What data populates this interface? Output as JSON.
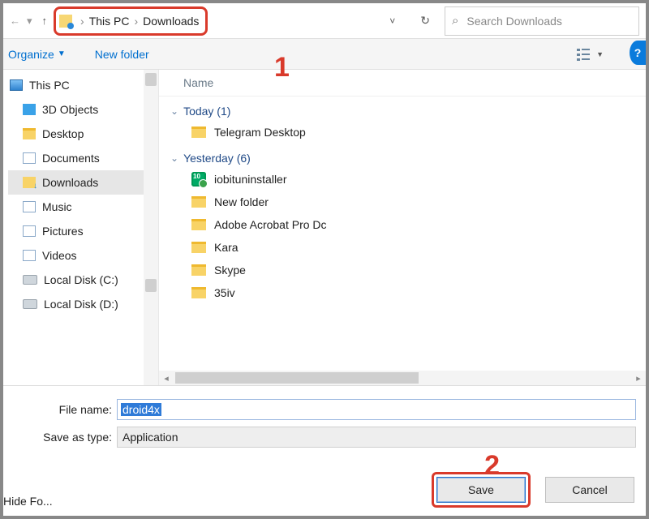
{
  "nav": {
    "back_disabled": "←",
    "fwd_disabled": "▾",
    "up": "↑",
    "crumbs": [
      "This PC",
      "Downloads"
    ],
    "sep": "›",
    "refresh": "↻",
    "search_placeholder": "Search Downloads"
  },
  "toolbar": {
    "organize": "Organize",
    "new_folder": "New folder",
    "help": "?"
  },
  "annotations": {
    "one": "1",
    "two": "2"
  },
  "tree": {
    "root": "This PC",
    "items": [
      {
        "label": "3D Objects"
      },
      {
        "label": "Desktop"
      },
      {
        "label": "Documents"
      },
      {
        "label": "Downloads",
        "selected": true
      },
      {
        "label": "Music"
      },
      {
        "label": "Pictures"
      },
      {
        "label": "Videos"
      },
      {
        "label": "Local Disk (C:)"
      },
      {
        "label": "Local Disk (D:)"
      }
    ]
  },
  "files": {
    "header_name": "Name",
    "groups": [
      {
        "title": "Today (1)",
        "items": [
          {
            "label": "Telegram Desktop",
            "kind": "folder"
          }
        ]
      },
      {
        "title": "Yesterday (6)",
        "items": [
          {
            "label": "iobituninstaller",
            "kind": "app"
          },
          {
            "label": "New folder",
            "kind": "folder"
          },
          {
            "label": "Adobe Acrobat Pro Dc",
            "kind": "folder"
          },
          {
            "label": "Kara",
            "kind": "folder"
          },
          {
            "label": "Skype",
            "kind": "folder"
          },
          {
            "label": "35iv",
            "kind": "folder"
          }
        ]
      }
    ]
  },
  "form": {
    "file_name_label": "File name:",
    "file_name_value": "droid4x",
    "save_type_label": "Save as type:",
    "save_type_value": "Application",
    "save": "Save",
    "cancel": "Cancel",
    "hide_folders": "Hide Fo..."
  }
}
